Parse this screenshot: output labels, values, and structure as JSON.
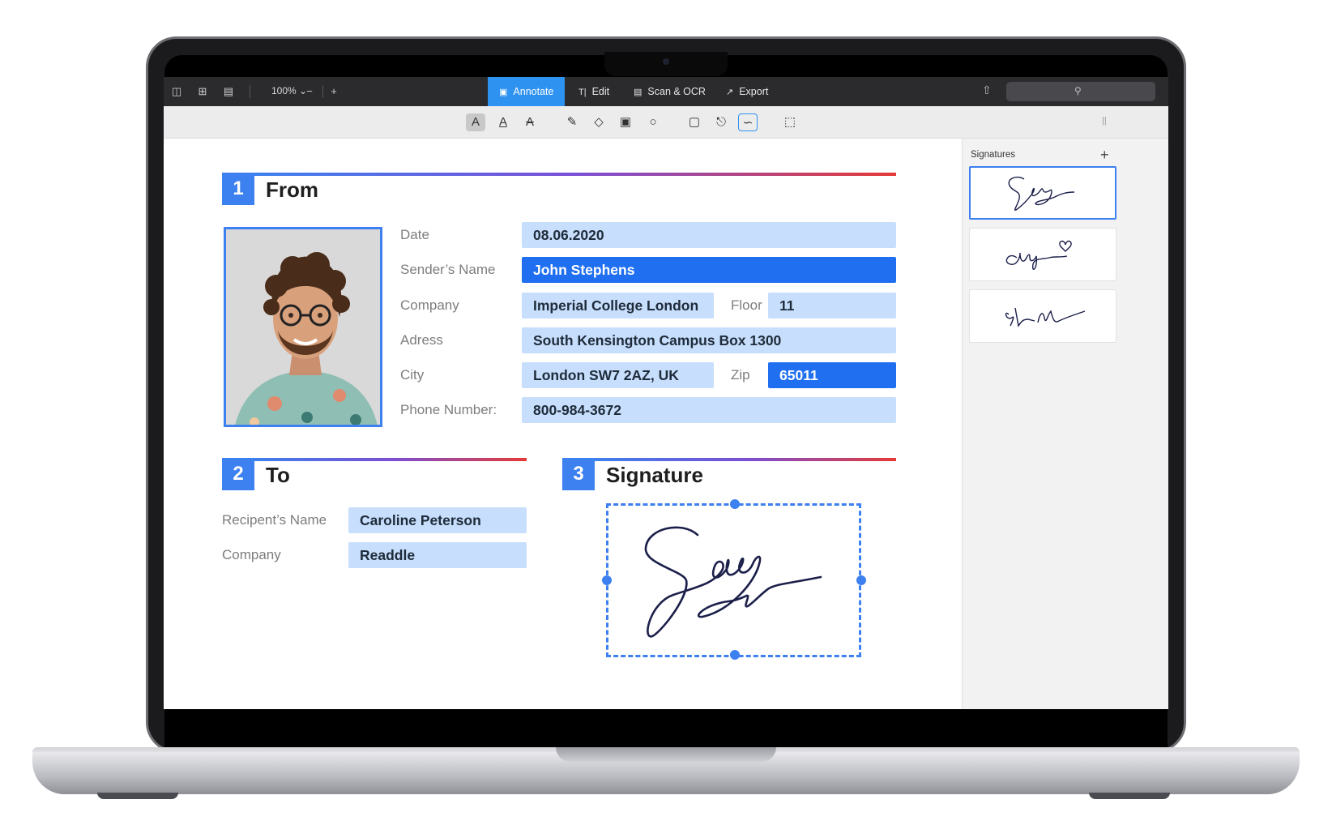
{
  "toolbar": {
    "zoom": "100%",
    "modes": [
      {
        "label": "Annotate",
        "icon": "annotate-icon",
        "active": true
      },
      {
        "label": "Edit",
        "icon": "text-cursor-icon",
        "active": false
      },
      {
        "label": "Scan & OCR",
        "icon": "scan-icon",
        "active": false
      },
      {
        "label": "Export",
        "icon": "export-icon",
        "active": false
      }
    ],
    "accent": "#2e92f0"
  },
  "document": {
    "sections": {
      "from": {
        "number": "1",
        "title": "From"
      },
      "to": {
        "number": "2",
        "title": "To"
      },
      "signature": {
        "number": "3",
        "title": "Signature"
      }
    },
    "from_fields": {
      "date": {
        "label": "Date",
        "value": "08.06.2020"
      },
      "sender_name": {
        "label": "Sender’s Name",
        "value": "John Stephens"
      },
      "company": {
        "label": "Company",
        "value": "Imperial College London"
      },
      "floor": {
        "label": "Floor",
        "value": "11"
      },
      "address": {
        "label": "Adress",
        "value": "South Kensington Campus Box 1300"
      },
      "city": {
        "label": "City",
        "value": "London SW7 2AZ, UK"
      },
      "zip": {
        "label": "Zip",
        "value": "65011"
      },
      "phone": {
        "label": "Phone Number:",
        "value": "800-984-3672"
      }
    },
    "to_fields": {
      "recipient_name": {
        "label": "Recipent’s Name",
        "value": "Caroline Peterson"
      },
      "company": {
        "label": "Company",
        "value": "Readdle"
      }
    },
    "field_color": "#c7defc",
    "field_active_color": "#1f6ff0",
    "section_color": "#3d80ef"
  },
  "sidebar": {
    "title": "Signatures",
    "add_icon": "plus-icon"
  }
}
